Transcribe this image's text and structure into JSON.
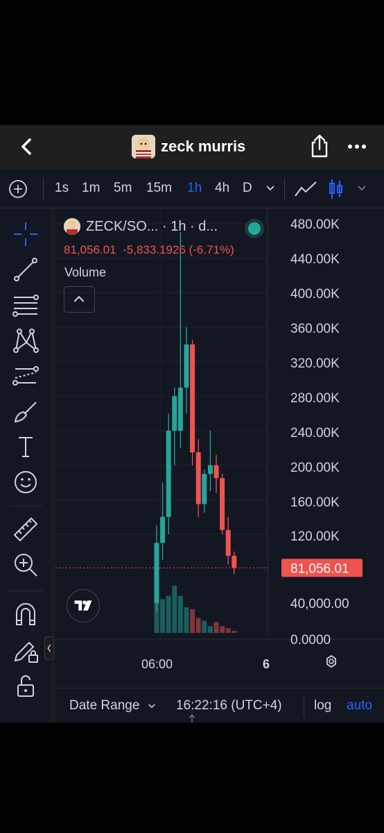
{
  "header": {
    "title": "zeck murris",
    "icons": [
      "back-icon",
      "avatar",
      "share-icon",
      "more-icon"
    ]
  },
  "timeframes": {
    "items": [
      "1s",
      "1m",
      "5m",
      "15m",
      "1h",
      "4h",
      "D"
    ],
    "active": "1h"
  },
  "left_toolbar": {
    "tools": [
      "crosshair-icon",
      "trend-line-icon",
      "fib-retracement-icon",
      "xabcd-pattern-icon",
      "projection-icon",
      "brush-icon",
      "text-icon",
      "emoji-icon",
      "ruler-icon",
      "zoom-in-icon",
      "magnet-icon",
      "lock-drawing-icon",
      "unlock-icon"
    ]
  },
  "legend": {
    "symbol": "ZECK/SO... · 1h · d...",
    "ohlc": "81,056.01  -5,833.1926 (-6.71%)",
    "volume_label": "Volume"
  },
  "price_scale": {
    "labels": [
      "480.00K",
      "440.00K",
      "400.00K",
      "360.00K",
      "320.00K",
      "280.00K",
      "240.00K",
      "200.00K",
      "160.00K",
      "120.00K",
      "40,000.00",
      "0.0000"
    ],
    "last_price": "81,056.01"
  },
  "time_scale": {
    "labels": [
      "06:00",
      "6"
    ]
  },
  "bottom_bar": {
    "date_range": "Date Range",
    "time": "16:22:16 (UTC+4)",
    "log": "log",
    "auto": "auto"
  },
  "colors": {
    "up": "#26a69a",
    "down": "#ef5350",
    "accent": "#2962ff",
    "background": "#131722"
  },
  "chart_data": {
    "type": "candlestick",
    "y_unit": "price",
    "ylim": [
      0,
      500000
    ],
    "last_price": 81056.01,
    "candles": [
      {
        "o": 40000,
        "h": 130000,
        "l": 30000,
        "c": 110000
      },
      {
        "o": 110000,
        "h": 180000,
        "l": 90000,
        "c": 140000
      },
      {
        "o": 140000,
        "h": 260000,
        "l": 120000,
        "c": 240000
      },
      {
        "o": 240000,
        "h": 290000,
        "l": 200000,
        "c": 280000
      },
      {
        "o": 240000,
        "h": 470000,
        "l": 220000,
        "c": 290000
      },
      {
        "o": 290000,
        "h": 360000,
        "l": 260000,
        "c": 340000
      },
      {
        "o": 340000,
        "h": 345000,
        "l": 200000,
        "c": 215000
      },
      {
        "o": 215000,
        "h": 230000,
        "l": 140000,
        "c": 155000
      },
      {
        "o": 155000,
        "h": 195000,
        "l": 145000,
        "c": 190000
      },
      {
        "o": 190000,
        "h": 240000,
        "l": 170000,
        "c": 200000
      },
      {
        "o": 200000,
        "h": 212000,
        "l": 168000,
        "c": 185000
      },
      {
        "o": 185000,
        "h": 190000,
        "l": 120000,
        "c": 125000
      },
      {
        "o": 125000,
        "h": 140000,
        "l": 85000,
        "c": 95000
      },
      {
        "o": 95000,
        "h": 100000,
        "l": 74000,
        "c": 81056.01
      }
    ],
    "volume_relative": [
      0.6,
      0.5,
      0.55,
      0.7,
      0.55,
      0.38,
      0.35,
      0.22,
      0.18,
      0.1,
      0.16,
      0.1,
      0.07,
      0.03
    ],
    "xlabels": [
      "06:00",
      "6"
    ]
  }
}
